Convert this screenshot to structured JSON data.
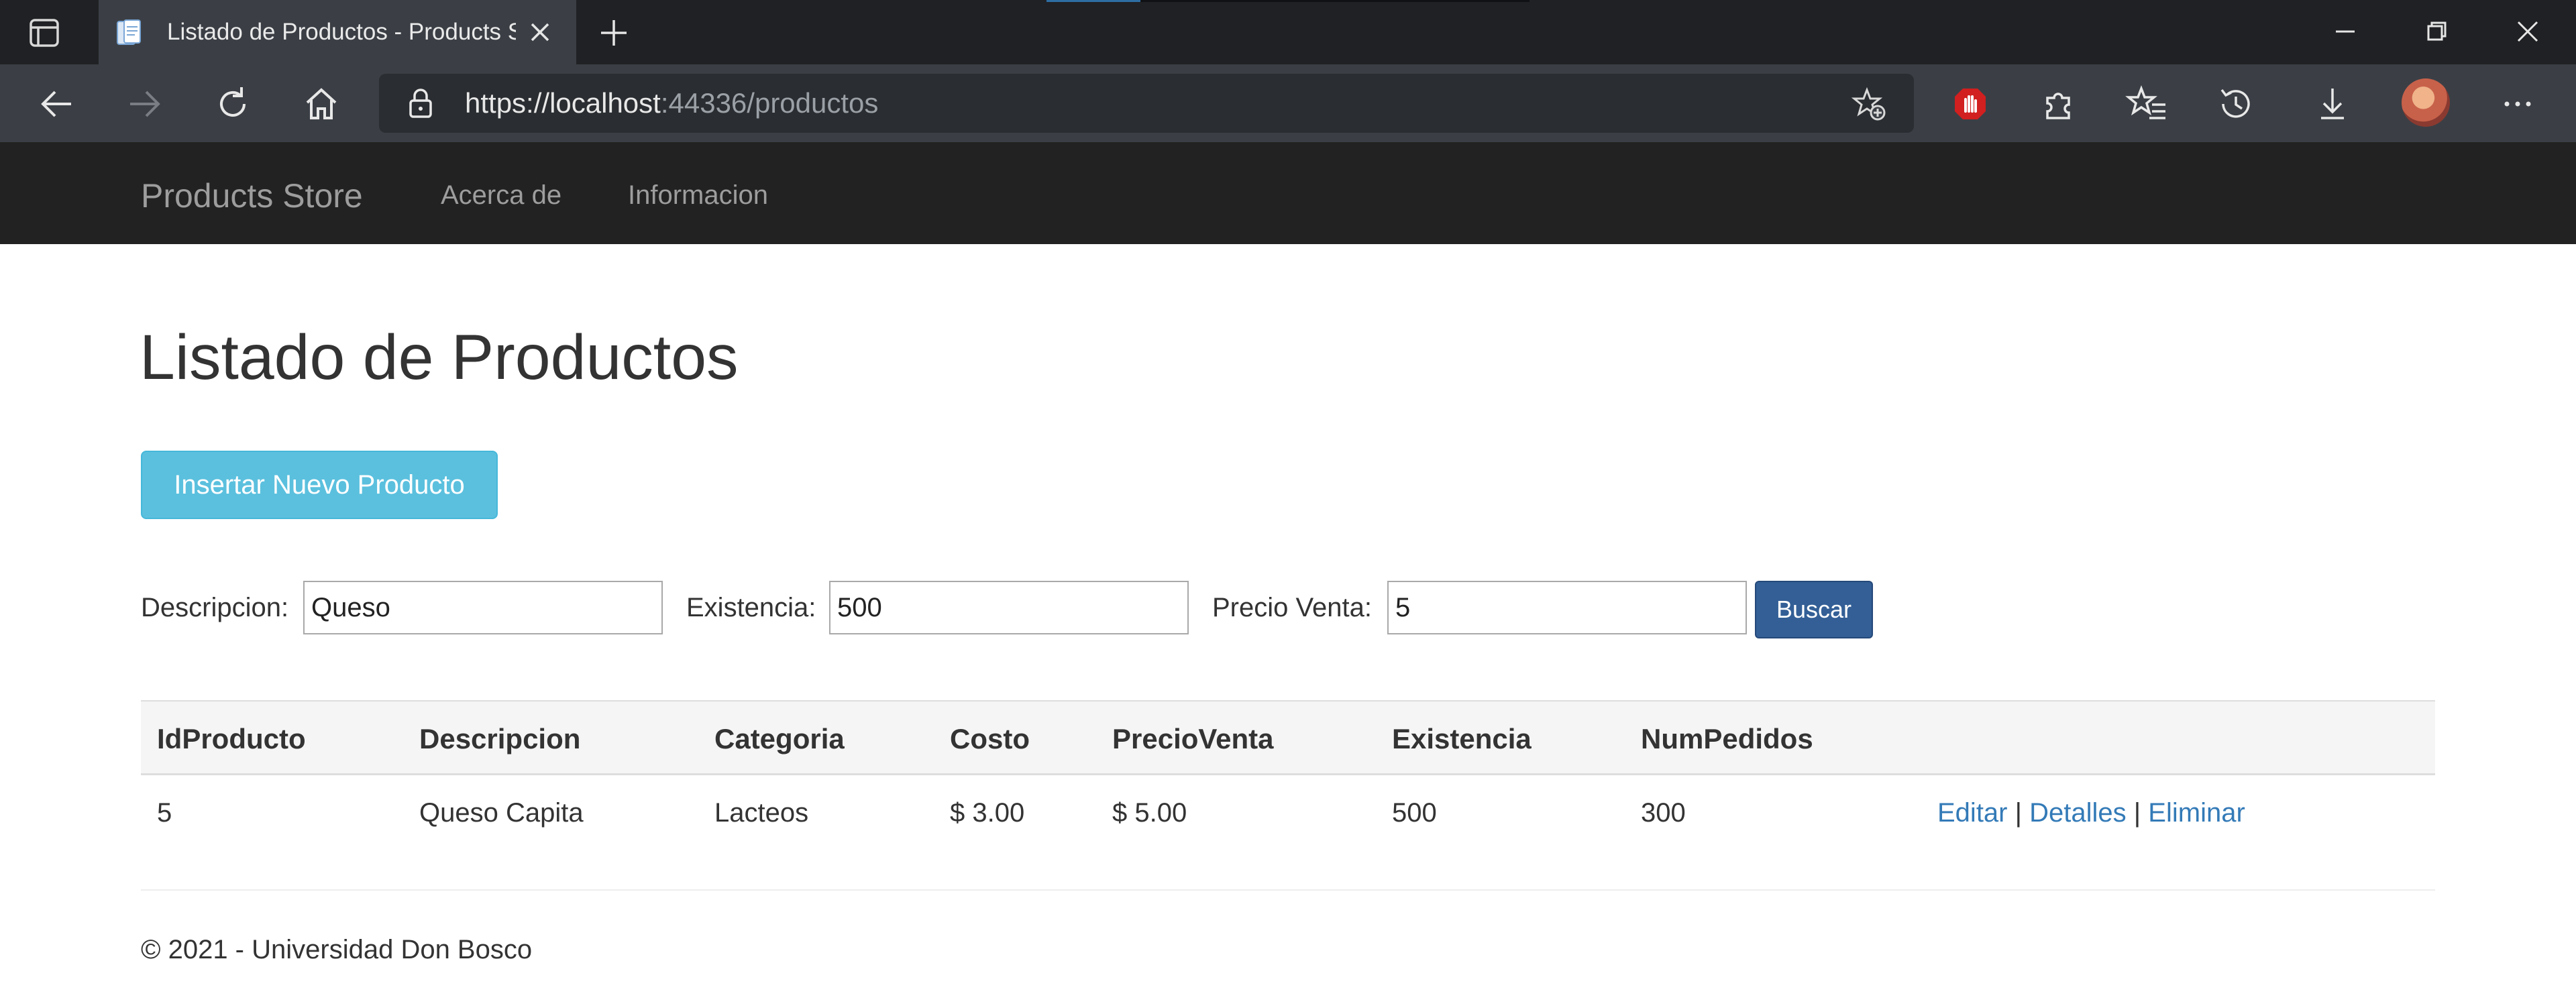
{
  "browser": {
    "tab_title": "Listado de Productos - Products Store",
    "url_prefix": "https://",
    "url_host": "localhost",
    "url_rest": ":44336/productos",
    "theme": {
      "tabbar": "#202124",
      "toolbar": "#3b3f45",
      "address": "#2a2d31"
    },
    "icons": [
      "tab-actions-icon",
      "page-favicon-icon",
      "close-icon",
      "plus-icon",
      "minimize-icon",
      "restore-icon",
      "close-window-icon",
      "back-icon",
      "forward-icon",
      "refresh-icon",
      "home-icon",
      "lock-icon",
      "add-favorite-icon",
      "adblock-icon",
      "extensions-icon",
      "favorites-icon",
      "history-icon",
      "download-icon",
      "profile-avatar",
      "more-icon"
    ]
  },
  "navbar": {
    "brand": "Products Store",
    "links": [
      "Acerca de",
      "Informacion"
    ],
    "background": "#222222"
  },
  "main": {
    "title": "Listado de Productos",
    "insert_button": "Insertar Nuevo Producto",
    "filters": {
      "descripcion_label": "Descripcion:",
      "descripcion_value": "Queso",
      "existencia_label": "Existencia:",
      "existencia_value": "500",
      "precio_label": "Precio Venta:",
      "precio_value": "5",
      "search_button": "Buscar"
    },
    "table": {
      "headers": [
        "IdProducto",
        "Descripcion",
        "Categoria",
        "Costo",
        "PrecioVenta",
        "Existencia",
        "NumPedidos"
      ],
      "rows": [
        {
          "cells": [
            "5",
            "Queso Capita",
            "Lacteos",
            "$ 3.00",
            "$ 5.00",
            "500",
            "300"
          ],
          "actions": {
            "edit": "Editar",
            "details": "Detalles",
            "delete": "Eliminar",
            "separator": "|"
          }
        }
      ]
    }
  },
  "footer": {
    "text": "© 2021 - Universidad Don Bosco"
  },
  "colors": {
    "info_button": "#5bc0de",
    "primary_button": "#335f96",
    "link": "#337ab7"
  }
}
